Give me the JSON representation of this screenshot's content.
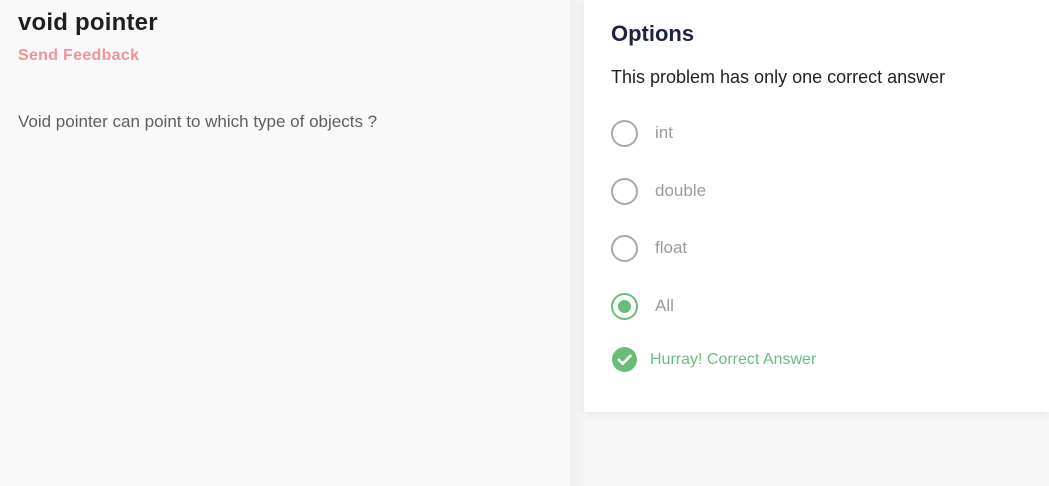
{
  "problem": {
    "title": "void pointer",
    "feedback_link": "Send Feedback",
    "question": "Void pointer can point to which type of objects ?"
  },
  "options_panel": {
    "heading": "Options",
    "instruction": "This problem has only one correct answer",
    "options": [
      {
        "label": "int",
        "selected": false
      },
      {
        "label": "double",
        "selected": false
      },
      {
        "label": "float",
        "selected": false
      },
      {
        "label": "All",
        "selected": true
      }
    ],
    "result_message": "Hurray! Correct Answer",
    "result_icon": "check-circle-icon"
  },
  "colors": {
    "accent_green": "#69bd79",
    "feedback_pink": "#f0939a",
    "heading_dark": "#1f2340"
  }
}
